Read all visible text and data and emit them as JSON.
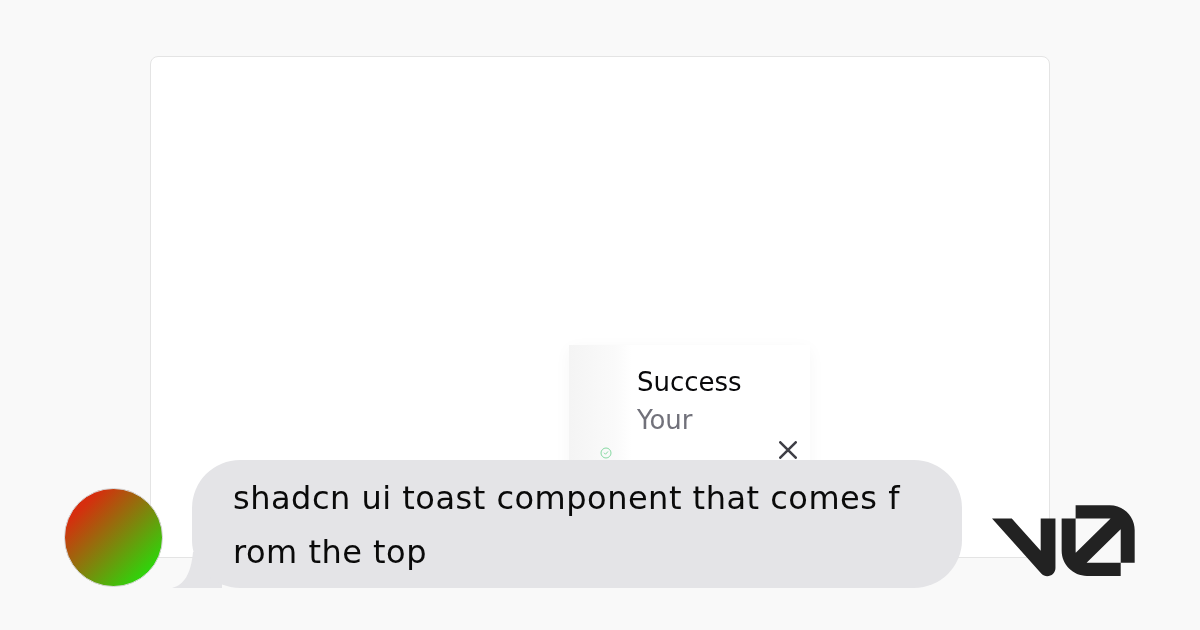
{
  "preview": {
    "toast": {
      "kind": "success",
      "title": "Success",
      "description": "Your"
    }
  },
  "chat": {
    "message": "shadcn ui toast component that comes from the top"
  }
}
